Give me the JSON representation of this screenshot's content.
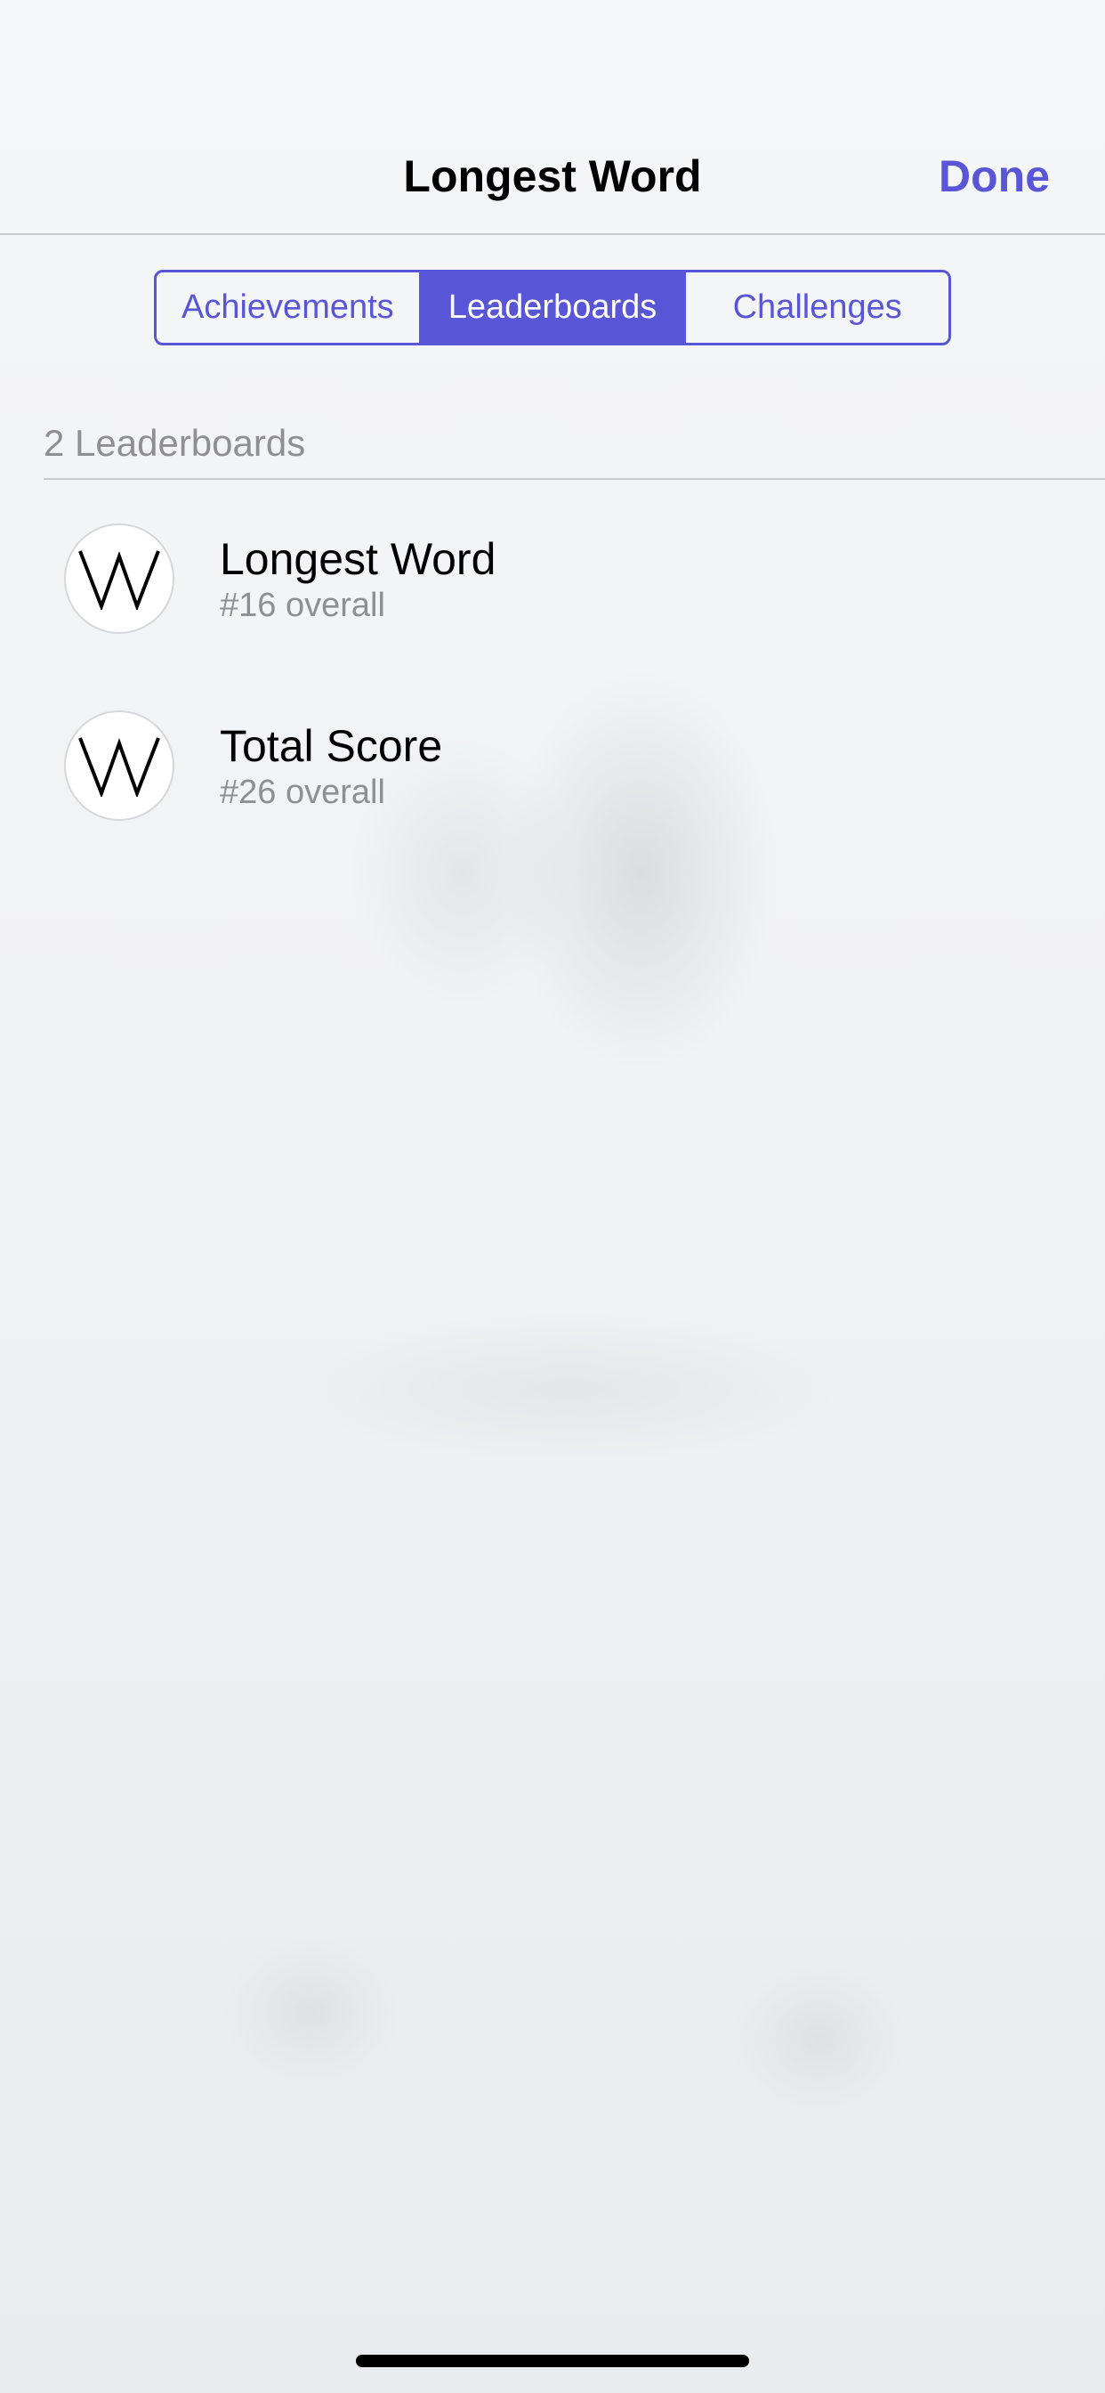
{
  "nav": {
    "title": "Longest Word",
    "done_label": "Done"
  },
  "tabs": [
    {
      "label": "Achievements",
      "selected": false
    },
    {
      "label": "Leaderboards",
      "selected": true
    },
    {
      "label": "Challenges",
      "selected": false
    }
  ],
  "section": {
    "header": "2 Leaderboards"
  },
  "leaderboards": [
    {
      "icon": "game-logo-w-icon",
      "title": "Longest Word",
      "rank": "#16 overall"
    },
    {
      "icon": "game-logo-w-icon",
      "title": "Total Score",
      "rank": "#26 overall"
    }
  ],
  "colors": {
    "accent": "#5856d6",
    "secondary_text": "#8e8e93",
    "divider": "#c8c9cd"
  }
}
